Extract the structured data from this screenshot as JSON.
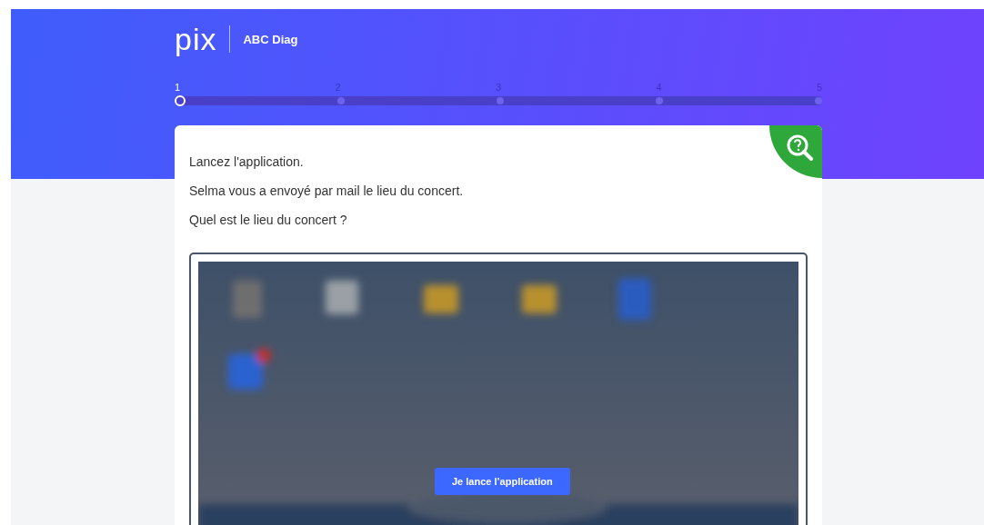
{
  "header": {
    "logo": "pix",
    "title": "ABC Diag"
  },
  "progress": {
    "steps": [
      {
        "label": "1",
        "selected": true
      },
      {
        "label": "2",
        "selected": false
      },
      {
        "label": "3",
        "selected": false
      },
      {
        "label": "4",
        "selected": false
      },
      {
        "label": "5",
        "selected": false
      }
    ]
  },
  "challenge": {
    "instructions": [
      "Lancez l'application.",
      "Selma vous a envoyé par mail le lieu du concert.",
      "Quel est le lieu du concert ?"
    ],
    "embed": {
      "kind": "picture",
      "button": "Je lance l’application"
    }
  }
}
